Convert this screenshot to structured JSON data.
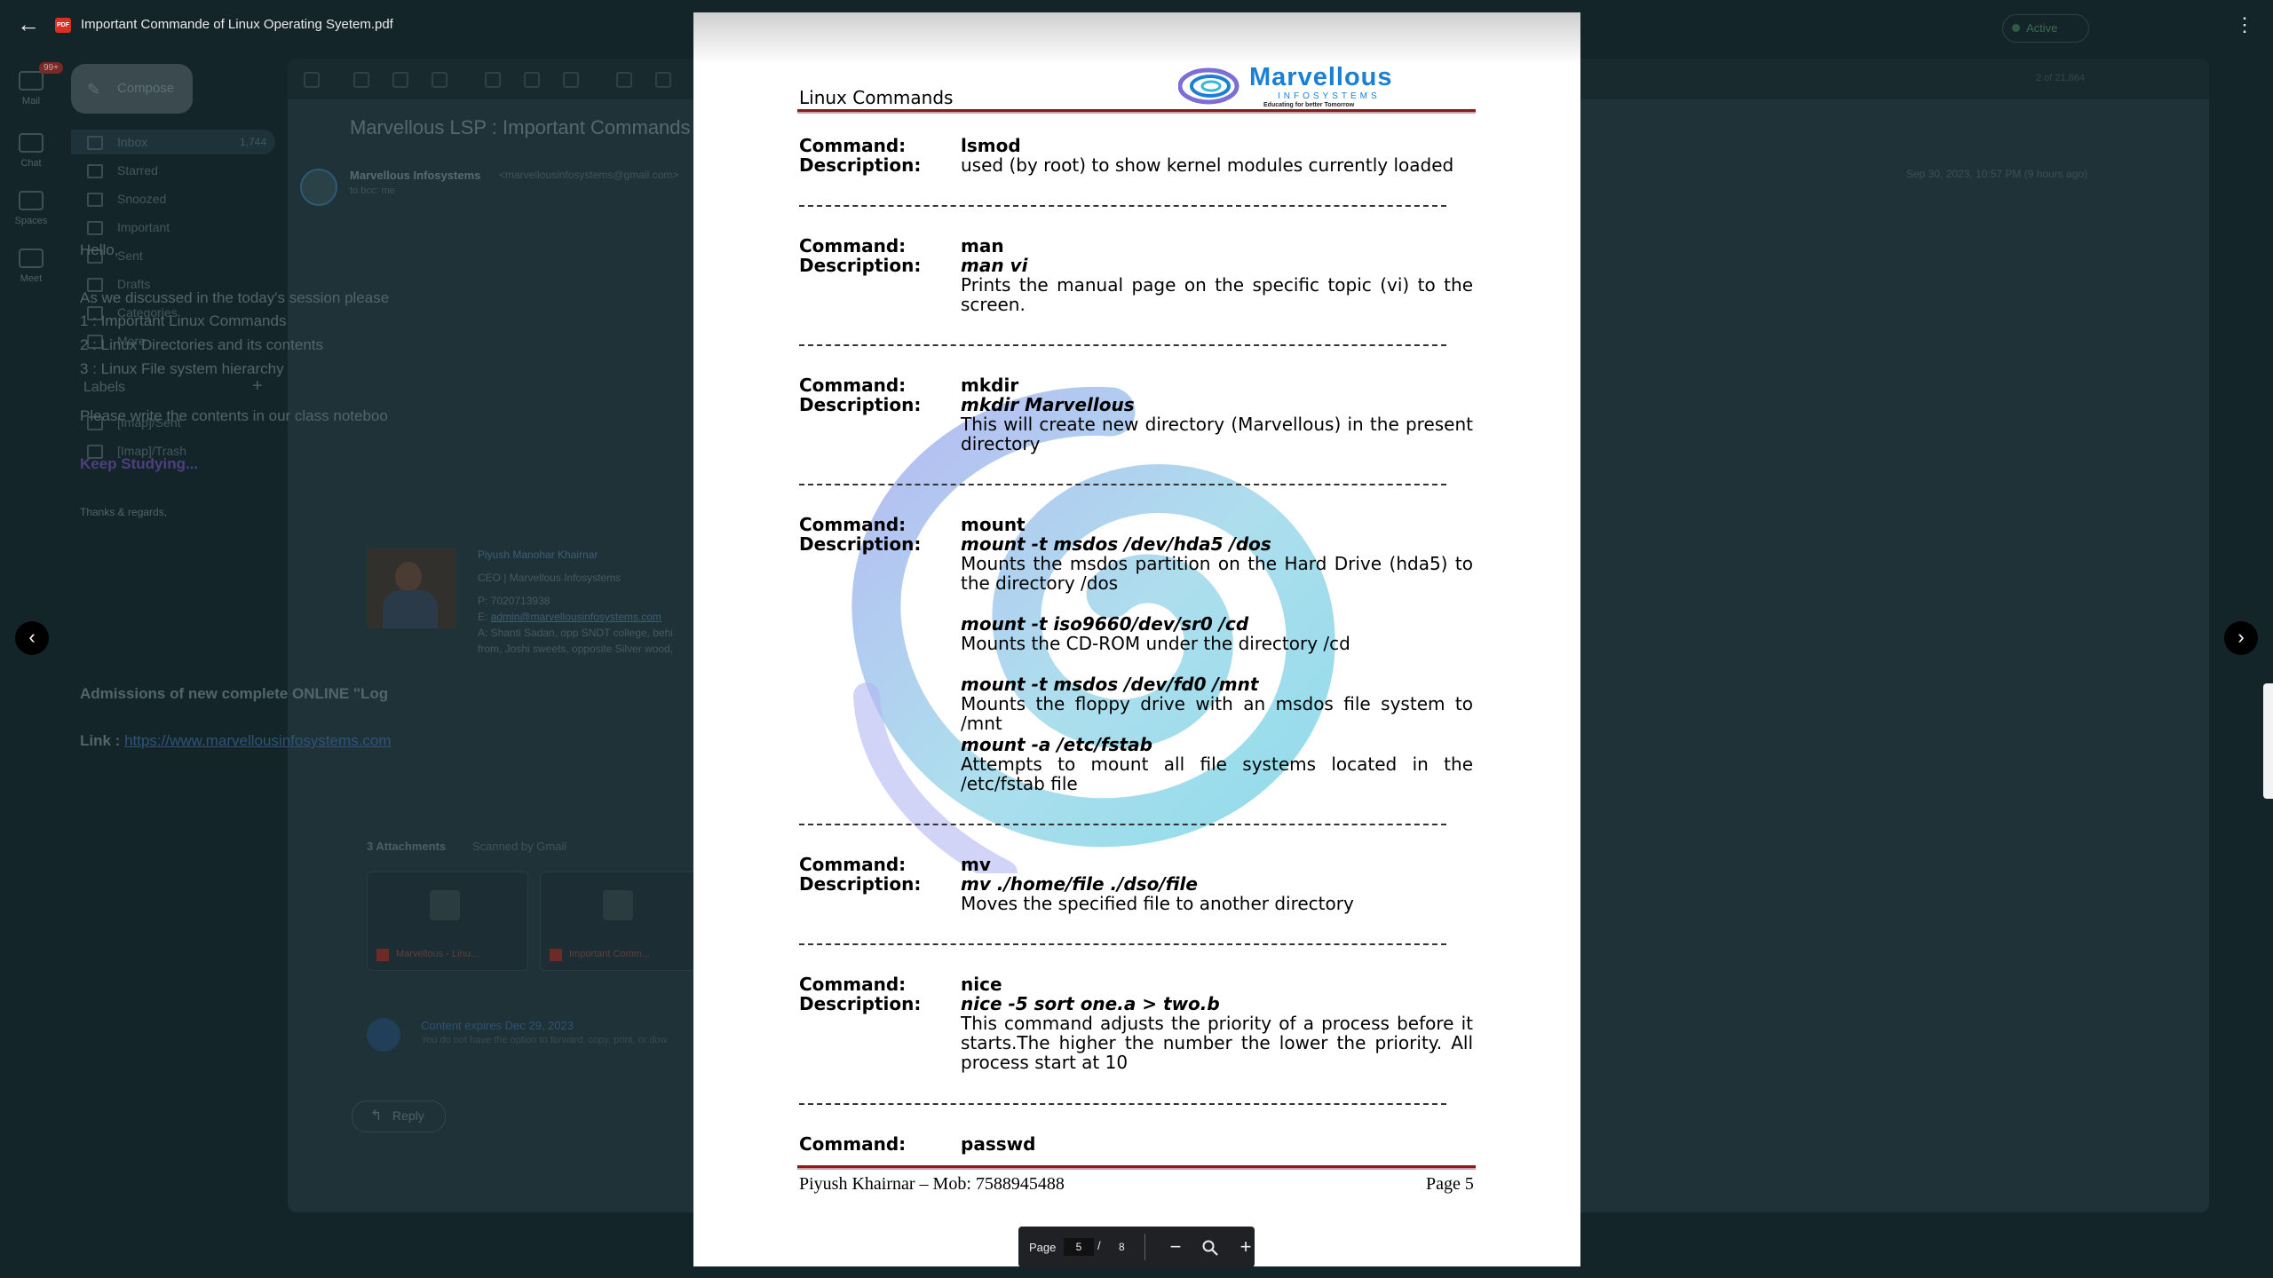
{
  "viewer": {
    "title": "Important Commande of Linux Operating Syetem.pdf",
    "pdf_badge": "PDF"
  },
  "gmail": {
    "rail": [
      {
        "label": "Mail",
        "badge": "99+"
      },
      {
        "label": "Chat"
      },
      {
        "label": "Spaces"
      },
      {
        "label": "Meet"
      }
    ],
    "compose_label": "Compose",
    "nav": [
      {
        "label": "Inbox",
        "count": "1,744"
      },
      {
        "label": "Starred"
      },
      {
        "label": "Snoozed"
      },
      {
        "label": "Important"
      },
      {
        "label": "Sent"
      },
      {
        "label": "Drafts"
      },
      {
        "label": "Categories"
      },
      {
        "label": "More"
      }
    ],
    "labels_title": "Labels",
    "labels": [
      "[Imap]/Sent",
      "[Imap]/Trash"
    ],
    "status": "Active",
    "page_info": "2 of 21,864",
    "subject": "Marvellous LSP : Important Commands",
    "sender_name": "Marvellous Infosystems",
    "sender_email": "<marvellousinfosystems@gmail.com>",
    "sender_to": "to bcc: me",
    "date": "Sep 30, 2023, 10:57 PM (9 hours ago)",
    "body": {
      "greeting": "Hello,",
      "intro": "As we discussed in the today's session please",
      "item1": "1 : Important Linux Commands",
      "item2": "2 : Linux Directories and its contents",
      "item3": "3 : Linux File system hierarchy",
      "write": "Please write the contents in our class noteboo",
      "keep": "Keep Studying...",
      "thanks": "Thanks & regards,"
    },
    "signature": {
      "name": "Piyush Manohar Khairnar",
      "role": "CEO | Marvellous Infosystems",
      "phone": "P:  7020713938",
      "email_prefix": "E:",
      "email": "admin@marvellousinfosystems.com",
      "address1": "A:  Shanti Sadan, opp SNDT college, behi",
      "address2": "from, Joshi sweets, opposite Silver wood,"
    },
    "admissions": "Admissions of new complete ONLINE \"Log",
    "link_label": "Link :",
    "link_url": "https://www.marvellousinfosystems.com",
    "attachments_title": "3 Attachments",
    "attachments_scanned": "Scanned by Gmail",
    "attachments": [
      "Marvellous - Linu...",
      "Important Comm..."
    ],
    "expires_title": "Content expires Dec 29, 2023",
    "expires_sub": "You do not have the option to forward, copy, print, or dow",
    "reply_label": "Reply"
  },
  "pdf": {
    "page_title": "Linux Commands",
    "logo_name": "Marvellous",
    "logo_sub": "INFOSYSTEMS",
    "logo_tag": "Educating for better Tomorrow",
    "key_command": "Command:",
    "key_description": "Description:",
    "commands": [
      {
        "name": "lsmod",
        "desc": "used (by root) to show kernel modules currently loaded"
      },
      {
        "name": "man",
        "example": "man vi",
        "desc": "Prints the manual page on the specific topic (vi) to the screen."
      },
      {
        "name": "mkdir",
        "example": "mkdir Marvellous",
        "desc": "This will create new directory (Marvellous) in the present directory"
      },
      {
        "name": "mount",
        "example": "mount -t msdos /dev/hda5 /dos",
        "desc": "Mounts the msdos partition on the Hard Drive (hda5) to the directory /dos",
        "example2": "mount -t iso9660/dev/sr0 /cd",
        "desc2": "Mounts the CD-ROM under the directory /cd",
        "example3": "mount -t msdos /dev/fd0 /mnt",
        "desc3": "Mounts the floppy drive with an msdos file system to /mnt",
        "example4": "mount -a /etc/fstab",
        "desc4": "Attempts to mount all file systems located in the /etc/fstab file"
      },
      {
        "name": "mv",
        "example": "mv ./home/file ./dso/file",
        "desc": "Moves the specified file to another directory"
      },
      {
        "name": "nice",
        "example": "nice -5 sort one.a > two.b",
        "desc": "This command adjusts the priority of a process before it starts.The higher the number the lower the priority. All process start at 10"
      },
      {
        "name": "passwd"
      }
    ],
    "footer_left": "Piyush Khairnar – Mob: 7588945488",
    "footer_right": "Page 5"
  },
  "page_control": {
    "label": "Page",
    "current": "5",
    "separator": "/",
    "total": "8"
  }
}
